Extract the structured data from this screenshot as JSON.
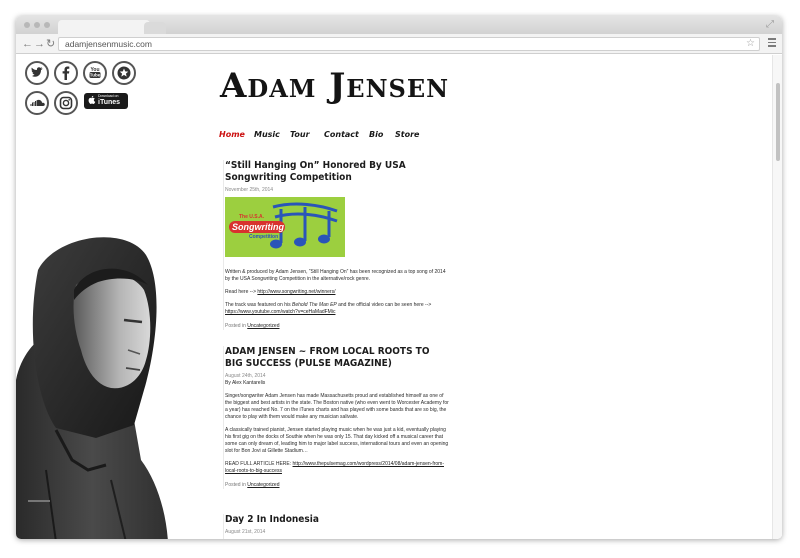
{
  "browser": {
    "url": "adamjensenmusic.com",
    "icons": [
      "back-arrow-icon",
      "forward-arrow-icon",
      "reload-icon",
      "star-icon",
      "menu-icon",
      "resize-icon"
    ]
  },
  "social": {
    "icons": [
      "twitter-icon",
      "facebook-icon",
      "youtube-icon",
      "star-badge-icon",
      "soundcloud-icon",
      "instagram-icon"
    ],
    "itunes_small": "Download on",
    "itunes_label": "iTunes"
  },
  "site": {
    "logo": "Adam Jensen",
    "nav": [
      "Home",
      "Music",
      "Tour",
      "Contact",
      "Bio",
      "Store"
    ],
    "nav_active": "Home",
    "accent_color": "#cc1111"
  },
  "posts": [
    {
      "title": "“Still Hanging On” Honored By USA Songwriting Competition",
      "date": "November 25th, 2014",
      "banner": {
        "the": "The U.S.A.",
        "songwriting": "Songwriting",
        "competition": "Competition"
      },
      "p1": "Written & produced by Adam Jensen, “Still Hanging On” has been recognized as a top song of 2014 by the USA Songwriting Competition in the alternative/rock genre.",
      "p2_prefix": "Read here --> ",
      "p2_link": "http://www.songwriting.net/winners/",
      "p3_before": "The track was featured on his ",
      "p3_em": "Behold The Man EP",
      "p3_after": " and the official video can be seen here -->",
      "p3_link": "https://www.youtube.com/watch?v=ceHaMadFMic",
      "posted_in_label": "Posted in",
      "category": "Uncategorized"
    },
    {
      "title": "ADAM JENSEN ~ FROM LOCAL ROOTS TO BIG SUCCESS (PULSE MAGAZINE)",
      "date": "August 24th, 2014",
      "author": "By Alex Kantarelis",
      "p1": "Singer/songwriter Adam Jensen has made Massachusetts proud and established himself as one of the biggest and best artists in the state. The Boston native (who even went to Worcester Academy for a year) has reached No. 7 on the iTunes charts and has played with some bands that are so big, the chance to play with them would make any musician salivate.",
      "p2": "A classically trained pianist, Jensen started playing music when he was just a kid, eventually playing his first gig on the docks of Southie when he was only 15. That day kicked off a musical career that some can only dream of, leading him to major label success, international tours and even an opening slot for Bon Jovi at Gillette Stadium…",
      "p3_prefix": "READ FULL ARTICLE HERE: ",
      "p3_link": "http://www.thepulsemag.com/wordpress/2014/08/adam-jensen-from-local-roots-to-big-success",
      "posted_in_label": "Posted in",
      "category": "Uncategorized"
    },
    {
      "title": "Day 2 In Indonesia",
      "date": "August 21st, 2014"
    }
  ]
}
